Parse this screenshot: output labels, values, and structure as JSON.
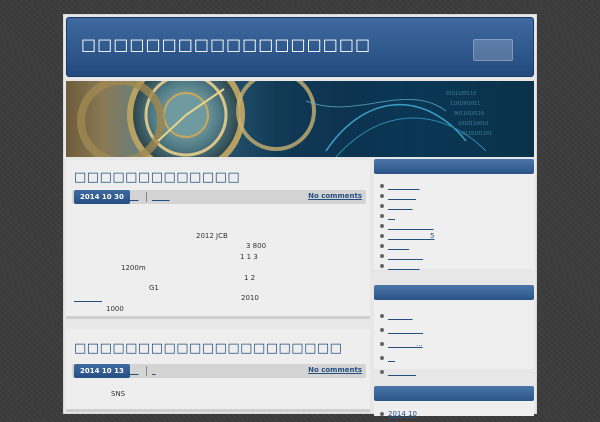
{
  "site": {
    "title": "□□□□□□□□□□□□□□□□□□"
  },
  "banner": {
    "alt": ""
  },
  "posts": [
    {
      "title": "□□□□□□□□□□□□□",
      "date": "2014 10 30",
      "category": "___",
      "tags": "_____",
      "comments": "No comments",
      "lines": [
        "2012      JCB",
        "3 800",
        "1                              1 3",
        "1200m",
        "1 2",
        "G1",
        "2010",
        "________",
        "1000"
      ]
    },
    {
      "title": "□□□□□□□□□□□□□□□□□□□□□",
      "date": "2014 10 13",
      "category": "___",
      "tags": "_",
      "comments": "No comments",
      "lines": [
        "SNS"
      ]
    }
  ],
  "sidebar": {
    "recent_posts": [
      "_________",
      "________",
      "_______",
      "__",
      "_____________",
      "____________5",
      "______",
      "__________",
      "_________"
    ],
    "categories": [
      "_______",
      "__________",
      "________...",
      "__",
      "________"
    ],
    "archives": [
      "2014 10"
    ]
  }
}
